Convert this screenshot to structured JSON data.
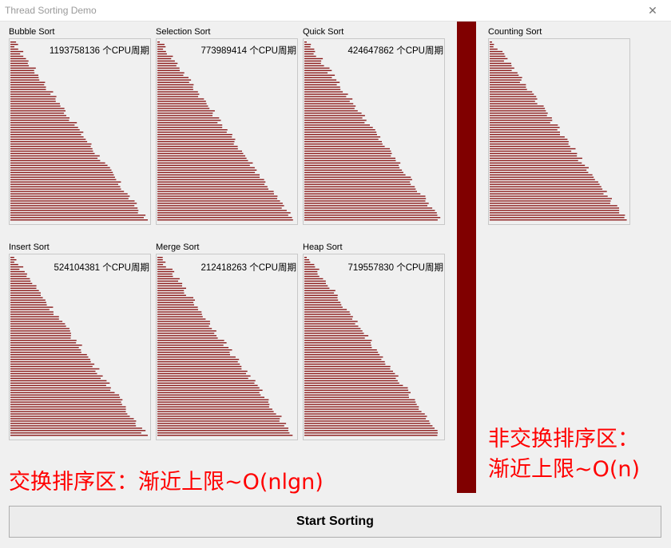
{
  "window": {
    "title": "Thread Sorting Demo",
    "close_glyph": "✕"
  },
  "bar_color": "#8b1a1a",
  "divider_color": "#800000",
  "caption_color": "#ff0000",
  "panels": [
    {
      "label": "Bubble Sort",
      "cycles": "1193758136 个CPU周期"
    },
    {
      "label": "Selection Sort",
      "cycles": "773989414 个CPU周期"
    },
    {
      "label": "Quick Sort",
      "cycles": "424647862 个CPU周期"
    },
    {
      "label": "Insert Sort",
      "cycles": "524104381 个CPU周期"
    },
    {
      "label": "Merge Sort",
      "cycles": "212418263 个CPU周期"
    },
    {
      "label": "Heap Sort",
      "cycles": "719557830 个CPU周期"
    },
    {
      "label": "Counting Sort",
      "cycles": ""
    }
  ],
  "captions": {
    "left": "交换排序区：渐近上限~O(nlgn)",
    "right_line1": "非交换排序区：",
    "right_line2": "渐近上限~O(n)"
  },
  "button": {
    "start_label": "Start Sorting"
  }
}
